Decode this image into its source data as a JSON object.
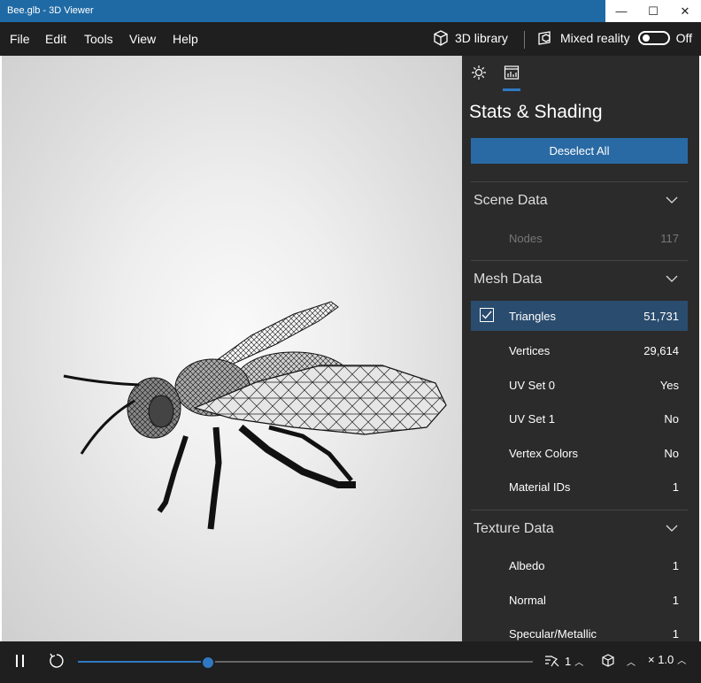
{
  "window": {
    "title": "Bee.glb - 3D Viewer",
    "minimize": "—",
    "maximize": "☐",
    "close": "✕"
  },
  "menu": {
    "file": "File",
    "edit": "Edit",
    "tools": "Tools",
    "view": "View",
    "help": "Help"
  },
  "toolbar": {
    "library_label": "3D library",
    "library_icon": "cube-icon",
    "mixed_reality_label": "Mixed reality",
    "mixed_reality_icon": "mixed-reality-icon",
    "mixed_reality_state": "Off"
  },
  "panel": {
    "tabs": [
      "lighting-icon",
      "stats-icon"
    ],
    "title": "Stats & Shading",
    "deselect_label": "Deselect All",
    "sections": {
      "scene": {
        "title": "Scene Data",
        "rows": [
          {
            "label": "Nodes",
            "value": "117"
          }
        ]
      },
      "mesh": {
        "title": "Mesh Data",
        "rows": [
          {
            "label": "Triangles",
            "value": "51,731"
          },
          {
            "label": "Vertices",
            "value": "29,614"
          },
          {
            "label": "UV Set 0",
            "value": "Yes"
          },
          {
            "label": "UV Set 1",
            "value": "No"
          },
          {
            "label": "Vertex Colors",
            "value": "No"
          },
          {
            "label": "Material IDs",
            "value": "1"
          }
        ]
      },
      "texture": {
        "title": "Texture Data",
        "rows": [
          {
            "label": "Albedo",
            "value": "1"
          },
          {
            "label": "Normal",
            "value": "1"
          },
          {
            "label": "Specular/Metallic",
            "value": "1"
          }
        ]
      }
    }
  },
  "bottom": {
    "play_icon": "pause-icon",
    "reset_icon": "reset-icon",
    "timeline_progress": 0.285,
    "animation_count": "1",
    "environment_icon": "cube-icon",
    "speed": "× 1.0"
  },
  "colors": {
    "accent": "#2f79c2",
    "title_bar": "#1f6aa5",
    "panel_bg": "#2b2b2b",
    "selected_row": "#2a4c6e"
  }
}
